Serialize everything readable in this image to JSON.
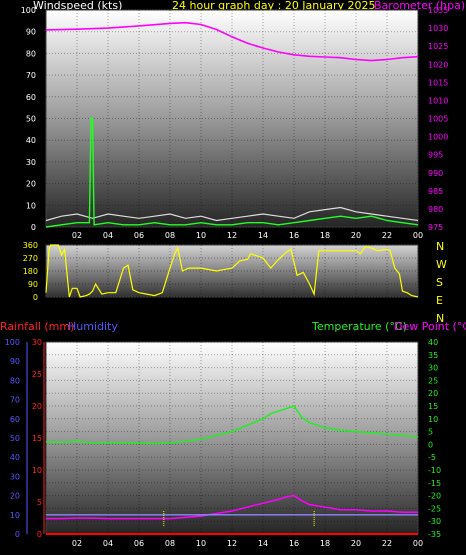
{
  "header": {
    "windspeed_label": "Windspeed (kts)",
    "title": "24 hour graph day : 20 January 2025",
    "barometer_label": "Barometer (hpa)"
  },
  "colors": {
    "wind_title": "#ffffff",
    "title": "#ffff00",
    "baro": "#ff00ff",
    "gust": "#dddddd",
    "wind": "#22ff22",
    "direction": "#ffff00",
    "rain": "#ff2222",
    "humidity": "#5555ff",
    "temperature": "#22ee22",
    "dewpoint": "#ff00ff",
    "compass": "#ffff00",
    "humidity_line": "#8888ff",
    "rain_line": "#ff0000",
    "sun_marker": "#ffff00"
  },
  "compass": [
    "N",
    "W",
    "S",
    "E",
    "N"
  ],
  "legend_lower": {
    "rain": "Rainfall (mm)",
    "humidity": "Humidity",
    "temperature": "Temperature (°C)",
    "dewpoint": "Dew Point (°C)"
  },
  "chart_data": [
    {
      "type": "line",
      "name": "wind_baro",
      "x_ticks": [
        "02",
        "04",
        "06",
        "08",
        "10",
        "12",
        "14",
        "16",
        "18",
        "20",
        "22",
        "00"
      ],
      "y_left_ticks": [
        0,
        10,
        20,
        30,
        40,
        50,
        60,
        70,
        80,
        90,
        100
      ],
      "y_left_range": [
        0,
        100
      ],
      "y_right_ticks": [
        975,
        980,
        985,
        990,
        995,
        1000,
        1005,
        1010,
        1015,
        1020,
        1025,
        1030,
        1035
      ],
      "y_right_range": [
        975,
        1035
      ],
      "series": [
        {
          "name": "Barometer (hpa)",
          "axis": "right",
          "x": [
            0,
            2,
            4,
            6,
            8,
            9,
            10,
            11,
            12,
            13,
            14,
            15,
            16,
            17,
            18,
            19,
            20,
            21,
            22,
            23,
            24
          ],
          "values": [
            1029.5,
            1029.7,
            1030.0,
            1030.6,
            1031.3,
            1031.5,
            1031.0,
            1029.6,
            1027.6,
            1025.8,
            1024.5,
            1023.4,
            1022.6,
            1022.2,
            1022.0,
            1021.8,
            1021.3,
            1021.0,
            1021.3,
            1021.8,
            1022.1
          ]
        },
        {
          "name": "Windspeed (kts)",
          "axis": "left",
          "x": [
            0,
            1,
            2,
            2.8,
            2.9,
            3.0,
            3.1,
            4,
            5,
            6,
            7,
            8,
            9,
            10,
            11,
            12,
            13,
            14,
            15,
            16,
            17,
            18,
            19,
            20,
            21,
            22,
            23,
            24
          ],
          "values": [
            0,
            1,
            2,
            2,
            50,
            50,
            1,
            2,
            1,
            1,
            2,
            1,
            1,
            2,
            1,
            1,
            2,
            2,
            1,
            2,
            3,
            4,
            5,
            4,
            5,
            3,
            2,
            1
          ]
        },
        {
          "name": "Gust",
          "axis": "left",
          "x": [
            0,
            1,
            2,
            3,
            4,
            5,
            6,
            7,
            8,
            9,
            10,
            11,
            12,
            13,
            14,
            15,
            16,
            17,
            18,
            19,
            20,
            21,
            22,
            23,
            24
          ],
          "values": [
            3,
            5,
            6,
            4,
            6,
            5,
            4,
            5,
            6,
            4,
            5,
            3,
            4,
            5,
            6,
            5,
            4,
            7,
            8,
            9,
            7,
            6,
            5,
            4,
            3
          ]
        }
      ]
    },
    {
      "type": "line",
      "name": "wind_direction",
      "x_ticks": [
        "02",
        "04",
        "06",
        "08",
        "10",
        "12",
        "14",
        "16",
        "18",
        "20",
        "22",
        "00"
      ],
      "y_ticks": [
        0,
        90,
        180,
        270,
        360
      ],
      "y_range": [
        0,
        360
      ],
      "series": [
        {
          "name": "Direction",
          "x": [
            0,
            0.2,
            0.3,
            0.5,
            0.8,
            1.0,
            1.2,
            1.5,
            1.7,
            2.0,
            2.2,
            2.6,
            2.8,
            3.0,
            3.2,
            3.6,
            4.0,
            4.5,
            5.0,
            5.3,
            5.6,
            6.0,
            6.5,
            7.0,
            7.5,
            8.0,
            8.3,
            8.5,
            8.8,
            9.2,
            10.0,
            11.0,
            12.0,
            12.5,
            13.0,
            13.2,
            14.0,
            14.5,
            15.0,
            15.5,
            15.8,
            16.0,
            16.2,
            16.6,
            17.0,
            17.3,
            17.6,
            20.0,
            20.3,
            20.6,
            21.0,
            21.4,
            22.0,
            22.2,
            22.5,
            22.8,
            23.0,
            23.3,
            23.6,
            24.0
          ],
          "values": [
            30,
            330,
            360,
            360,
            360,
            290,
            330,
            0,
            60,
            60,
            0,
            10,
            20,
            40,
            90,
            20,
            30,
            30,
            200,
            220,
            50,
            30,
            20,
            10,
            30,
            200,
            300,
            340,
            180,
            200,
            200,
            180,
            200,
            250,
            260,
            300,
            270,
            200,
            260,
            310,
            330,
            240,
            150,
            170,
            90,
            20,
            320,
            320,
            300,
            350,
            340,
            320,
            330,
            320,
            200,
            160,
            40,
            30,
            10,
            0
          ]
        }
      ]
    },
    {
      "type": "line",
      "name": "temp_humidity",
      "x_ticks": [
        "02",
        "04",
        "06",
        "08",
        "10",
        "12",
        "14",
        "16",
        "18",
        "20",
        "22",
        "00"
      ],
      "y_left1_ticks": [
        0,
        10,
        20,
        30,
        40,
        50,
        60,
        70,
        80,
        90,
        100
      ],
      "y_left1_range": [
        0,
        100
      ],
      "y_left2_ticks": [
        0,
        5,
        10,
        15,
        20,
        25,
        30
      ],
      "y_left2_range": [
        0,
        30
      ],
      "y_right_ticks": [
        -35,
        -30,
        -25,
        -20,
        -15,
        -10,
        -5,
        0,
        5,
        10,
        15,
        20,
        25,
        30,
        35,
        40
      ],
      "y_right_range": [
        -35,
        40
      ],
      "series": [
        {
          "name": "Temperature (°C)",
          "axis": "right",
          "x": [
            0,
            1,
            2,
            3,
            4,
            5,
            6,
            7,
            8,
            9,
            10,
            11,
            12,
            13,
            14,
            14.5,
            15,
            15.5,
            16,
            16.5,
            17,
            18,
            19,
            20,
            21,
            22,
            23,
            24
          ],
          "values": [
            1.0,
            0.8,
            1.2,
            0.5,
            0.8,
            0.6,
            0.6,
            0.3,
            0.6,
            1.2,
            2.0,
            3.5,
            5.0,
            7.5,
            10.0,
            12.0,
            13.0,
            14.0,
            15.0,
            10.5,
            8.5,
            6.5,
            5.5,
            5.0,
            4.5,
            4.0,
            3.5,
            3.0
          ]
        },
        {
          "name": "Dew Point (°C)",
          "axis": "right",
          "x": [
            0,
            1,
            2,
            3,
            4,
            5,
            6,
            7,
            8,
            9,
            10,
            11,
            12,
            13,
            14,
            15,
            15.5,
            16,
            16.5,
            17,
            18,
            19,
            20,
            21,
            22,
            23,
            24
          ],
          "values": [
            -29.0,
            -29.0,
            -28.8,
            -28.8,
            -29.0,
            -29.0,
            -29.0,
            -29.0,
            -29.0,
            -28.5,
            -28.0,
            -27.0,
            -26.0,
            -24.5,
            -23.0,
            -21.5,
            -20.5,
            -20.0,
            -22.0,
            -23.5,
            -24.5,
            -25.5,
            -25.5,
            -26.0,
            -26.0,
            -26.5,
            -26.5
          ]
        },
        {
          "name": "Humidity",
          "axis": "left1",
          "x": [
            0,
            24
          ],
          "values": [
            10,
            10
          ]
        },
        {
          "name": "Rainfall (mm)",
          "axis": "left2",
          "x": [
            0,
            24
          ],
          "values": [
            0,
            0
          ]
        }
      ]
    }
  ]
}
